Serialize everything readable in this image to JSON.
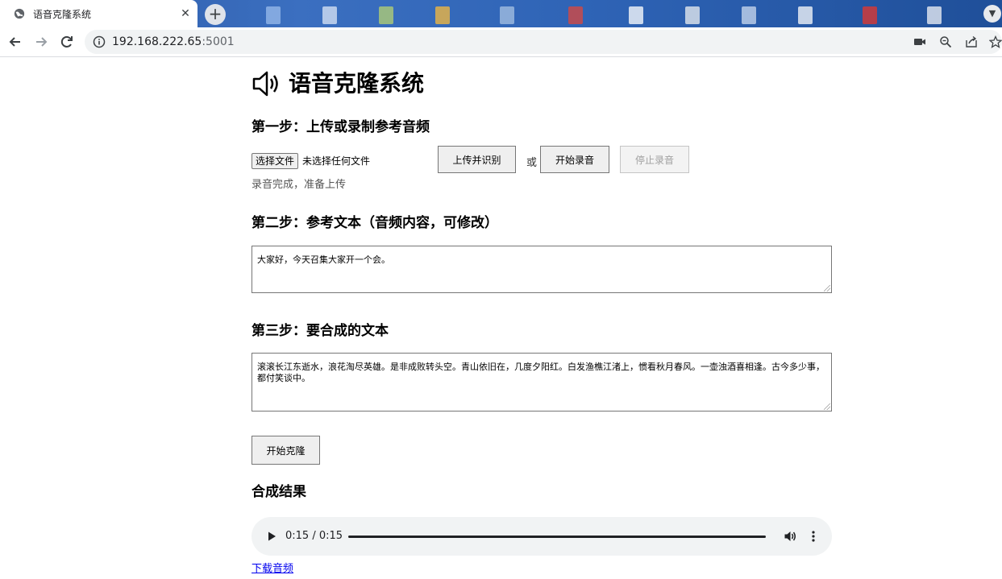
{
  "browser": {
    "tab_title": "语音克隆系统",
    "url_host": "192.168.222.65",
    "url_port": ":5001"
  },
  "page": {
    "title": "语音克隆系统",
    "step1": {
      "heading": "第一步：上传或录制参考音频",
      "choose_file_label": "选择文件",
      "file_status": "未选择任何文件",
      "upload_button": "上传并识别",
      "or_text": "或",
      "start_record_button": "开始录音",
      "stop_record_button": "停止录音",
      "record_status": "录音完成，准备上传"
    },
    "step2": {
      "heading": "第二步：参考文本（音频内容，可修改）",
      "text": "大家好，今天召集大家开一个会。"
    },
    "step3": {
      "heading": "第三步：要合成的文本",
      "text": "滚滚长江东逝水，浪花淘尽英雄。是非成败转头空。青山依旧在，几度夕阳红。白发渔樵江渚上，惯看秋月春风。一壶浊酒喜相逢。古今多少事，都付笑谈中。"
    },
    "clone_button": "开始克隆",
    "result": {
      "heading": "合成结果",
      "audio_time": "0:15 / 0:15",
      "audio_progress": 1.0,
      "download_link": "下载音频"
    }
  },
  "colors": {
    "link": "#0000ee",
    "button_bg": "#efefef",
    "audio_bg": "#f1f3f4"
  }
}
